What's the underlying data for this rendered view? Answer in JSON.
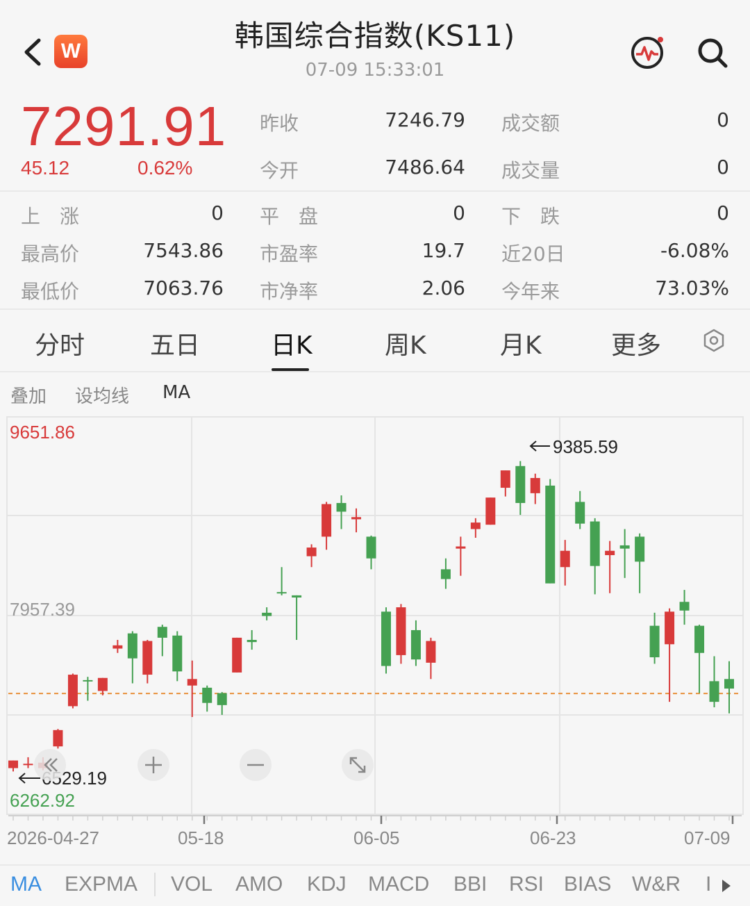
{
  "header": {
    "title": "韩国综合指数(KS11)",
    "timestamp": "07-09 15:33:01",
    "logo_text": "W"
  },
  "quote": {
    "price": "7291.91",
    "change": "45.12",
    "change_pct": "0.62%",
    "color_up": "#d83a3a"
  },
  "stats_top": [
    {
      "label": "昨收",
      "value": "7246.79"
    },
    {
      "label": "今开",
      "value": "7486.64"
    },
    {
      "label": "成交额",
      "value": "0"
    },
    {
      "label": "成交量",
      "value": "0"
    }
  ],
  "stats_grid": [
    {
      "label": "上　涨",
      "value": "0"
    },
    {
      "label": "平　盘",
      "value": "0"
    },
    {
      "label": "下　跌",
      "value": "0"
    },
    {
      "label": "最高价",
      "value": "7543.86"
    },
    {
      "label": "市盈率",
      "value": "19.7"
    },
    {
      "label": "近20日",
      "value": "-6.08%"
    },
    {
      "label": "最低价",
      "value": "7063.76"
    },
    {
      "label": "市净率",
      "value": "2.06"
    },
    {
      "label": "今年来",
      "value": "73.03%"
    }
  ],
  "tabs": [
    "分时",
    "五日",
    "日K",
    "周K",
    "月K",
    "更多"
  ],
  "active_tab": "日K",
  "chart_options": [
    "叠加",
    "设均线",
    "MA"
  ],
  "indicators": [
    "MA",
    "EXPMA",
    "VOL",
    "AMO",
    "KDJ",
    "MACD",
    "BBI",
    "RSI",
    "BIAS",
    "W&R",
    "I"
  ],
  "active_indicator": "MA",
  "chart_data": {
    "type": "candlestick",
    "y_max_label": "9651.86",
    "y_mid_label": "7957.39",
    "y_min_label": "6262.92",
    "high_annotation": "9385.59",
    "low_annotation": "6529.19",
    "x_labels": [
      "2026-04-27",
      "05-18",
      "06-05",
      "06-23",
      "07-09"
    ],
    "ylim": [
      6262.92,
      9651.86
    ],
    "reference_price": 7246.79,
    "up_color": "#d83a3a",
    "down_color": "#45a152",
    "candles": [
      {
        "o": 6560,
        "c": 6630,
        "h": 6630,
        "l": 6529.19
      },
      {
        "o": 6590,
        "c": 6600,
        "h": 6660,
        "l": 6560
      },
      {
        "o": 6560,
        "c": 6610,
        "h": 6660,
        "l": 6540
      },
      {
        "o": 6760,
        "c": 6910,
        "h": 6920,
        "l": 6740
      },
      {
        "o": 7130,
        "c": 7420,
        "h": 7430,
        "l": 7110
      },
      {
        "o": 7370,
        "c": 7360,
        "h": 7400,
        "l": 7180
      },
      {
        "o": 7270,
        "c": 7390,
        "h": 7390,
        "l": 7230
      },
      {
        "o": 7660,
        "c": 7690,
        "h": 7740,
        "l": 7620
      },
      {
        "o": 7800,
        "c": 7570,
        "h": 7820,
        "l": 7340
      },
      {
        "o": 7420,
        "c": 7730,
        "h": 7740,
        "l": 7340
      },
      {
        "o": 7860,
        "c": 7760,
        "h": 7880,
        "l": 7590
      },
      {
        "o": 7780,
        "c": 7450,
        "h": 7820,
        "l": 7360
      },
      {
        "o": 7320,
        "c": 7380,
        "h": 7550,
        "l": 7030
      },
      {
        "o": 7300,
        "c": 7160,
        "h": 7320,
        "l": 7080
      },
      {
        "o": 7250,
        "c": 7140,
        "h": 7260,
        "l": 7050
      },
      {
        "o": 7440,
        "c": 7760,
        "h": 7760,
        "l": 7440
      },
      {
        "o": 7740,
        "c": 7720,
        "h": 7830,
        "l": 7650
      },
      {
        "o": 7990,
        "c": 7960,
        "h": 8040,
        "l": 7920
      },
      {
        "o": 8180,
        "c": 8170,
        "h": 8410,
        "l": 8150
      },
      {
        "o": 8150,
        "c": 8130,
        "h": 8150,
        "l": 7740
      },
      {
        "o": 8510,
        "c": 8590,
        "h": 8620,
        "l": 8410
      },
      {
        "o": 8690,
        "c": 8990,
        "h": 9010,
        "l": 8570
      },
      {
        "o": 9000,
        "c": 8920,
        "h": 9070,
        "l": 8760
      },
      {
        "o": 8850,
        "c": 8870,
        "h": 8950,
        "l": 8730
      },
      {
        "o": 8690,
        "c": 8490,
        "h": 8700,
        "l": 8390
      },
      {
        "o": 8000,
        "c": 7500,
        "h": 8040,
        "l": 7430
      },
      {
        "o": 7600,
        "c": 8040,
        "h": 8070,
        "l": 7520
      },
      {
        "o": 7830,
        "c": 7560,
        "h": 7920,
        "l": 7500
      },
      {
        "o": 7530,
        "c": 7730,
        "h": 7760,
        "l": 7380
      },
      {
        "o": 8390,
        "c": 8300,
        "h": 8490,
        "l": 8210
      },
      {
        "o": 8580,
        "c": 8600,
        "h": 8690,
        "l": 8330
      },
      {
        "o": 8760,
        "c": 8820,
        "h": 8860,
        "l": 8680
      },
      {
        "o": 8800,
        "c": 9050,
        "h": 9050,
        "l": 8800
      },
      {
        "o": 9140,
        "c": 9300,
        "h": 9300,
        "l": 9060
      },
      {
        "o": 9340,
        "c": 9000,
        "h": 9385.59,
        "l": 8890
      },
      {
        "o": 9090,
        "c": 9230,
        "h": 9270,
        "l": 8990
      },
      {
        "o": 9160,
        "c": 8260,
        "h": 9220,
        "l": 8260
      },
      {
        "o": 8410,
        "c": 8560,
        "h": 8660,
        "l": 8240
      },
      {
        "o": 9010,
        "c": 8810,
        "h": 9110,
        "l": 8760
      },
      {
        "o": 8830,
        "c": 8420,
        "h": 8860,
        "l": 8160
      },
      {
        "o": 8520,
        "c": 8560,
        "h": 8650,
        "l": 8170
      },
      {
        "o": 8610,
        "c": 8580,
        "h": 8760,
        "l": 8310
      },
      {
        "o": 8690,
        "c": 8460,
        "h": 8720,
        "l": 8170
      },
      {
        "o": 7870,
        "c": 7580,
        "h": 7990,
        "l": 7520
      },
      {
        "o": 7700,
        "c": 8000,
        "h": 8030,
        "l": 7170
      },
      {
        "o": 8090,
        "c": 8010,
        "h": 8200,
        "l": 7880
      },
      {
        "o": 7870,
        "c": 7620,
        "h": 7880,
        "l": 7250
      },
      {
        "o": 7360,
        "c": 7170,
        "h": 7590,
        "l": 7120
      },
      {
        "o": 7380,
        "c": 7291.91,
        "h": 7543.86,
        "l": 7063.76
      }
    ]
  }
}
